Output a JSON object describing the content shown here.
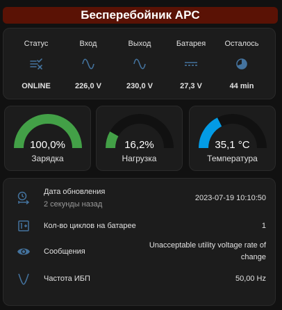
{
  "header": {
    "title": "Бесперебойник APC"
  },
  "status": [
    {
      "label": "Статус",
      "icon": "list-check-icon",
      "value": "ONLINE"
    },
    {
      "label": "Вход",
      "icon": "sine-wave-icon",
      "value": "226,0 V"
    },
    {
      "label": "Выход",
      "icon": "sine-wave-icon",
      "value": "230,0 V"
    },
    {
      "label": "Батарея",
      "icon": "dc-current-icon",
      "value": "27,3 V"
    },
    {
      "label": "Осталось",
      "icon": "timer-icon",
      "value": "44 min"
    }
  ],
  "gauges": [
    {
      "value": "100,0%",
      "name": "Зарядка",
      "fraction": 1.0,
      "color": "#43a047"
    },
    {
      "value": "16,2%",
      "name": "Нагрузка",
      "fraction": 0.162,
      "color": "#43a047"
    },
    {
      "value": "35,1 °C",
      "name": "Температура",
      "fraction": 0.351,
      "color": "#039be5"
    }
  ],
  "info": [
    {
      "name": "Дата обновления",
      "sub": "2 секунды назад",
      "value": "2023-07-19 10:10:50",
      "icon": "clock-arrow-icon"
    },
    {
      "name": "Кол-во циклов на батарее",
      "value": "1",
      "icon": "battery-counter-icon"
    },
    {
      "name": "Сообщения",
      "value_line1": "Unacceptable utility voltage rate of",
      "value_line2": "change",
      "icon": "eye-icon"
    },
    {
      "name": "Частота ИБП",
      "value": "50,00 Hz",
      "icon": "frequency-icon"
    }
  ],
  "colors": {
    "title_bg": "#5a1205",
    "card_bg": "#1c1c1c",
    "icon": "#44739e",
    "gauge_track": "#111111"
  }
}
